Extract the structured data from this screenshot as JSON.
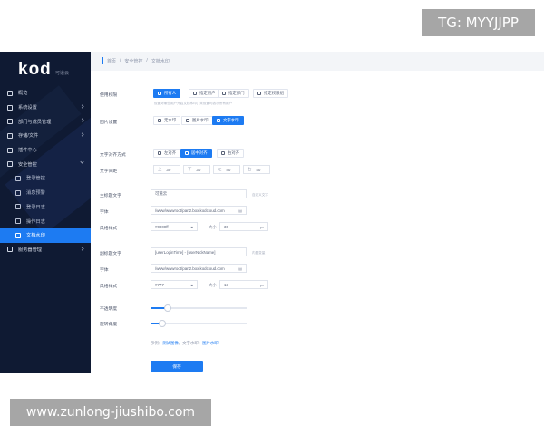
{
  "watermarks": {
    "top": "TG: MYYJJPP",
    "bottom": "www.zunlong-jiushibo.com"
  },
  "sidebar": {
    "logo": "kod",
    "logo_sub": "可道云",
    "items": [
      {
        "label": "概览",
        "icon": "chart-icon",
        "sub": false,
        "caret": ""
      },
      {
        "label": "系统设置",
        "icon": "gear-icon",
        "sub": false,
        "caret": "right"
      },
      {
        "label": "部门与成员管理",
        "icon": "users-icon",
        "sub": false,
        "caret": "right"
      },
      {
        "label": "存储/文件",
        "icon": "storage-icon",
        "sub": false,
        "caret": "right"
      },
      {
        "label": "插件中心",
        "icon": "plugin-icon",
        "sub": false,
        "caret": ""
      },
      {
        "label": "安全管控",
        "icon": "shield-icon",
        "sub": false,
        "caret": "down"
      },
      {
        "label": "登录管控",
        "icon": "login-icon",
        "sub": true,
        "caret": ""
      },
      {
        "label": "消息预警",
        "icon": "bell-icon",
        "sub": true,
        "caret": ""
      },
      {
        "label": "登录日志",
        "icon": "log-icon",
        "sub": true,
        "caret": ""
      },
      {
        "label": "操作日志",
        "icon": "log-icon",
        "sub": true,
        "caret": ""
      },
      {
        "label": "文档水印",
        "icon": "watermark-icon",
        "sub": true,
        "caret": "",
        "active": true
      },
      {
        "label": "服务器管理",
        "icon": "server-icon",
        "sub": false,
        "caret": "right"
      }
    ]
  },
  "breadcrumb": {
    "home": "首页",
    "sep1": "/",
    "section": "安全管控",
    "sep2": "/",
    "page": "文档水印"
  },
  "form": {
    "scope_label": "使用权限",
    "scope_options": [
      "所有人",
      "指定用户",
      "指定部门",
      "指定权限组"
    ],
    "scope_hint": "设置对哪些用户开启文档水印；未设置时表示所有用户",
    "image_label": "图片设置",
    "image_options": [
      "无水印",
      "图片水印",
      "文字水印"
    ],
    "align_label": "文字对齐方式",
    "align_options": [
      "左对齐",
      "居中对齐",
      "右对齐"
    ],
    "spacing_label": "文字间距",
    "spacing": [
      {
        "tag": "上",
        "value": "30"
      },
      {
        "tag": "下",
        "value": "30"
      },
      {
        "tag": "左",
        "value": "40"
      },
      {
        "tag": "右",
        "value": "40"
      }
    ],
    "main_text_label": "主标题文字",
    "main_text_value": "可道云",
    "main_text_hint": "自定义文字",
    "font_label_1": "字体",
    "font_value_1": "/www/wwwroot/pan2.box.kodcloud.com",
    "style_label_1": "风格样式",
    "color_value_1": "#0000ff",
    "size_label_1": "大小",
    "size_value_1": "30",
    "size_unit_1": "px",
    "sub_text_label": "副标题文字",
    "sub_text_value": "[userLoginTime] - [userNickName]",
    "sub_text_hint": "内置变量",
    "font_label_2": "字体",
    "font_value_2": "/www/wwwroot/pan2.box.kodcloud.com",
    "style_label_2": "风格样式",
    "color_value_2": "#777",
    "size_label_2": "大小",
    "size_value_2": "13",
    "size_unit_2": "px",
    "opacity_label": "不透明度",
    "opacity_value": 0.18,
    "rotate_label": "旋转角度",
    "rotate_value": 0.12,
    "links_prefix": "示例：",
    "link_1": "测试图像",
    "links_sep": "，文字水印：",
    "link_2": "图片水印",
    "save_label": "保存"
  }
}
